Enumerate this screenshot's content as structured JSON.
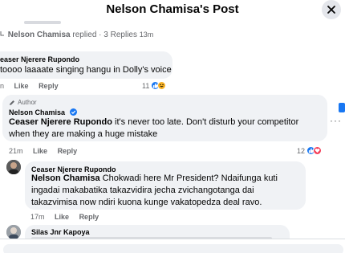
{
  "header": {
    "title": "Nelson Chamisa's Post"
  },
  "thread": {
    "name": "Nelson Chamisa",
    "replied": "replied · 3 Replies",
    "time": "13m"
  },
  "comments": [
    {
      "author": "easer Njerere Rupondo",
      "text": "toooo laaaate singing hangu in Dolly's voice",
      "time": "n",
      "like": "Like",
      "reply": "Reply",
      "reactions": "11"
    },
    {
      "badge": "Author",
      "author": "Nelson Chamisa",
      "tag": "Ceaser Njerere Rupondo",
      "text": " it's never too late. Don't disturb your competitor when they are making a huge mistake",
      "time": "21m",
      "like": "Like",
      "reply": "Reply",
      "reactions": "12"
    },
    {
      "author": "Ceaser Njerere Rupondo",
      "tag": "Nelson Chamisa",
      "text": " Chokwadi here Mr President? Ndaifunga kuti ingadai makabatika takazvidira jecha zvichangotanga dai takazvimisa now ndiri kuona kunge vakatopedza deal ravo.",
      "time": "17m",
      "like": "Like",
      "reply": "Reply"
    },
    {
      "author": "Silas Jnr Kapoya"
    }
  ],
  "colors": {
    "accent": "#1877f2",
    "bubble": "#f0f2f5",
    "meta": "#65676b"
  }
}
